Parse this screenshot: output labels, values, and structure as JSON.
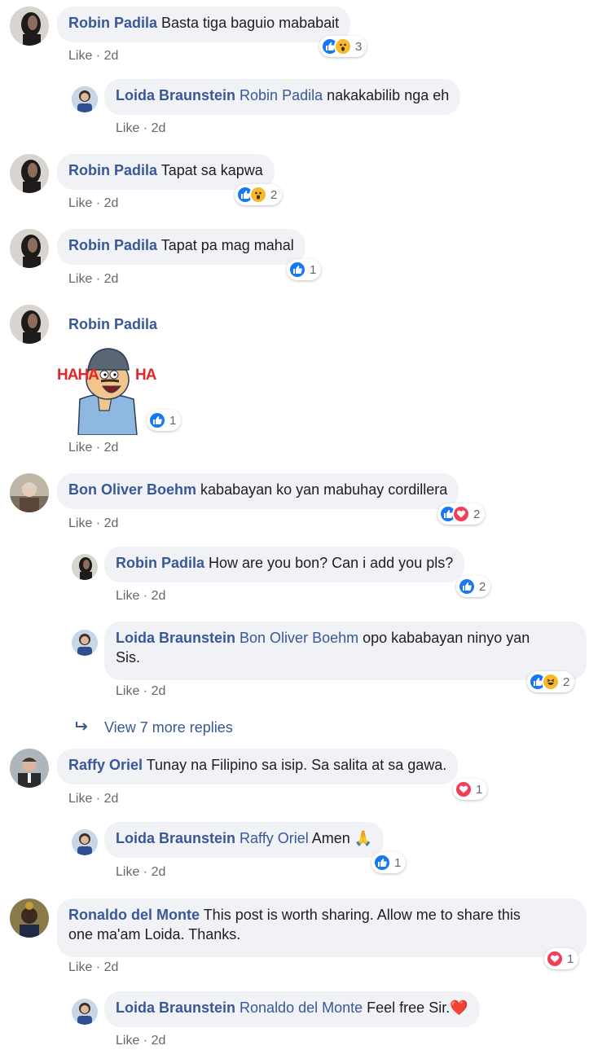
{
  "comments": [
    {
      "author": "Robin Padila",
      "text": "Basta tiga baguio mababait",
      "time": "2d",
      "like": "Like",
      "reactions": "3"
    },
    {
      "author": "Loida Braunstein",
      "mention": "Robin Padila",
      "text": "nakakabilib nga eh",
      "time": "2d",
      "like": "Like"
    },
    {
      "author": "Robin Padila",
      "text": "Tapat sa kapwa",
      "time": "2d",
      "like": "Like",
      "reactions": "2"
    },
    {
      "author": "Robin Padila",
      "text": "Tapat pa mag mahal",
      "time": "2d",
      "like": "Like",
      "reactions": "1"
    },
    {
      "author": "Robin Padila",
      "sticker_left": "HAHA",
      "sticker_right": "HA",
      "time": "2d",
      "like": "Like",
      "reactions": "1"
    },
    {
      "author": "Bon Oliver Boehm",
      "text": "kababayan ko yan mabuhay cordillera",
      "time": "2d",
      "like": "Like",
      "reactions": "2"
    },
    {
      "author": "Robin Padila",
      "text": "How are you bon? Can i add you pls?",
      "time": "2d",
      "like": "Like",
      "reactions": "2"
    },
    {
      "author": "Loida Braunstein",
      "mention": "Bon Oliver Boehm",
      "text_line1": "opo kababayan ninyo yan",
      "text_line2": "Sis.",
      "time": "2d",
      "like": "Like",
      "reactions": "2"
    },
    {
      "author": "Raffy Oriel",
      "text": "Tunay na Filipino sa isip. Sa salita at sa gawa.",
      "time": "2d",
      "like": "Like",
      "reactions": "1"
    },
    {
      "author": "Loida Braunstein",
      "mention": "Raffy Oriel",
      "text": "Amen 🙏",
      "time": "2d",
      "like": "Like",
      "reactions": "1"
    },
    {
      "author": "Ronaldo del Monte",
      "text_line1": "This post is worth sharing. Allow me to share this",
      "text_line2": "one ma'am Loida. Thanks.",
      "time": "2d",
      "like": "Like",
      "reactions": "1"
    },
    {
      "author": "Loida Braunstein",
      "mention": "Ronaldo del Monte",
      "text": "Feel free Sir.❤️",
      "time": "2d",
      "like": "Like"
    }
  ],
  "view_more": "View 7 more replies",
  "colors": {
    "link": "#385898",
    "bubble": "#f0f2f5",
    "like_blue": "#1877f2",
    "love_red": "#f33e58",
    "wow_yellow": "#f7b928"
  }
}
